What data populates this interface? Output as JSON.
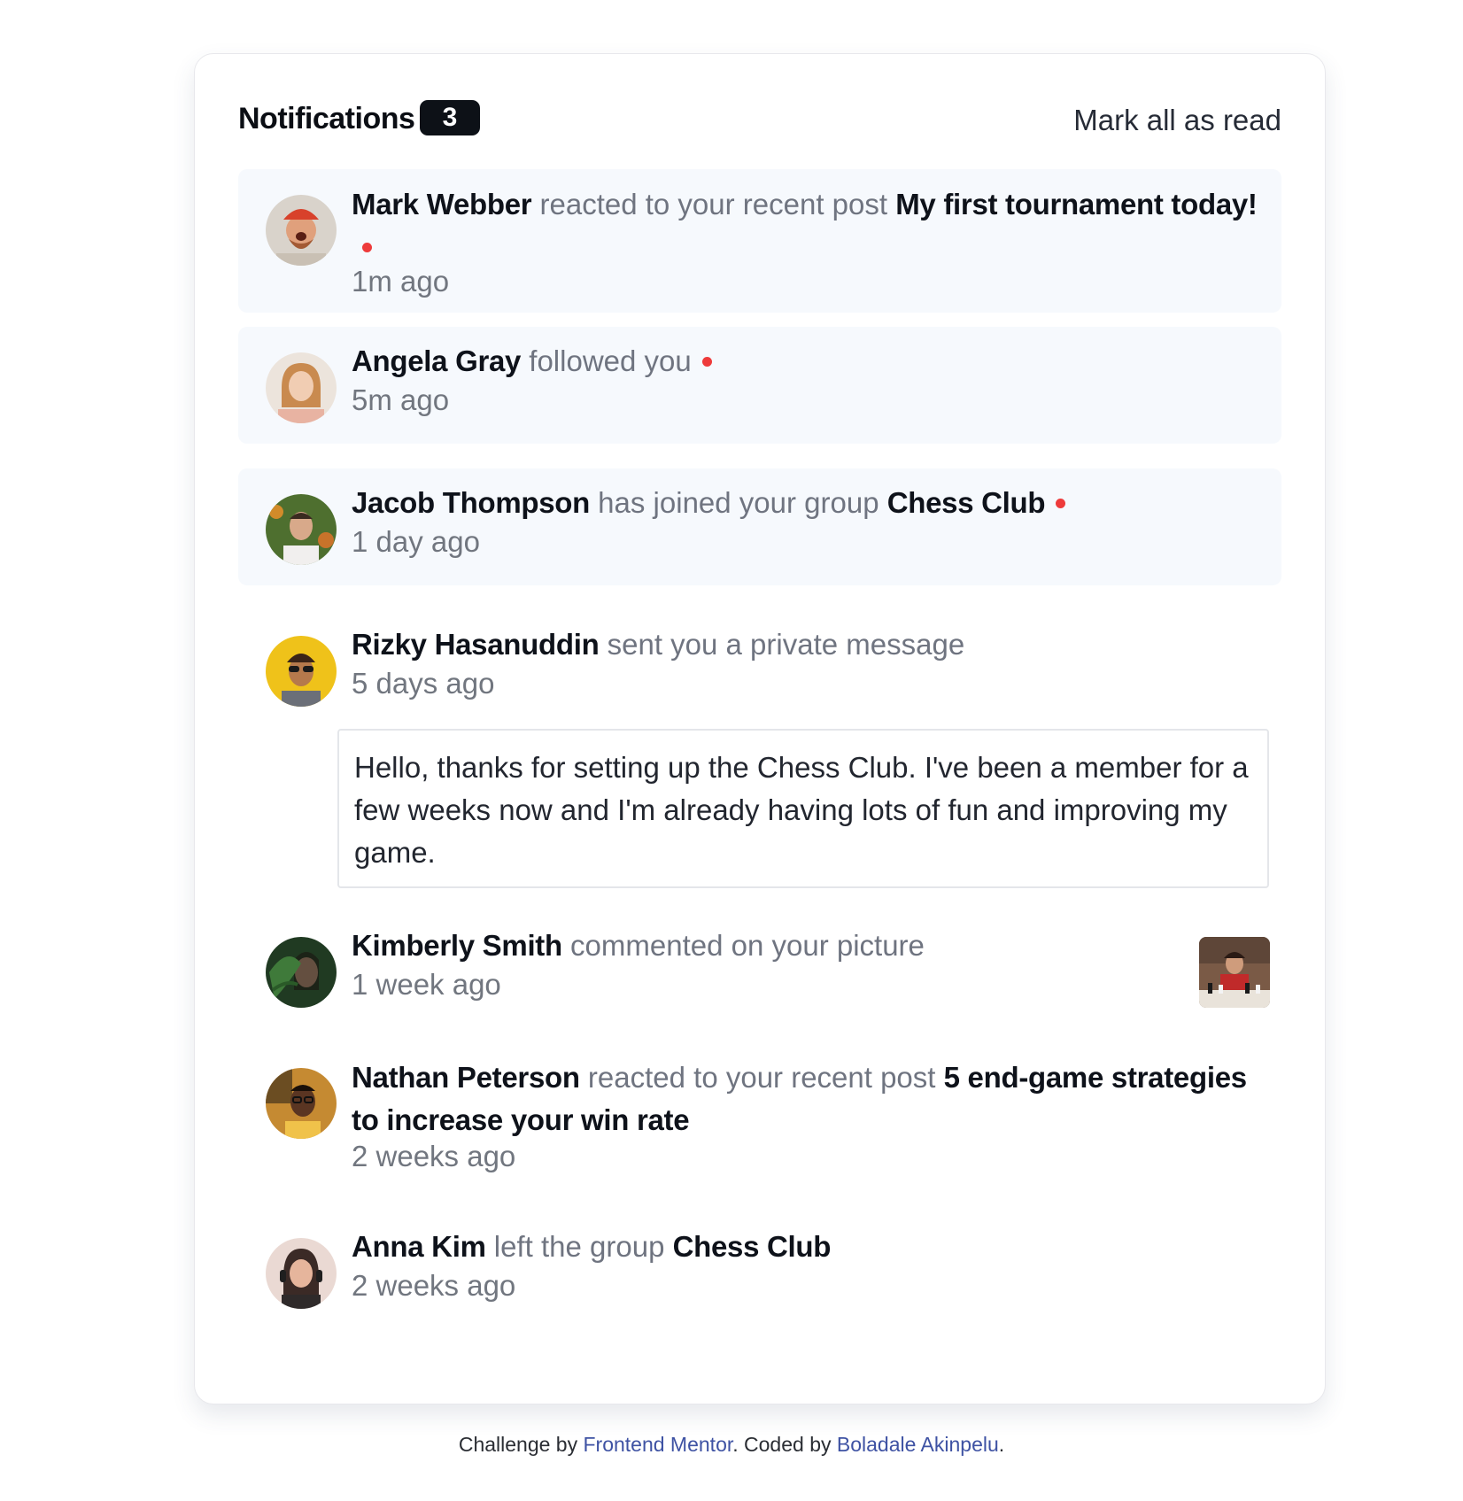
{
  "header": {
    "title": "Notifications",
    "unread_count": "3",
    "mark_all_label": "Mark all as read"
  },
  "notifications": [
    {
      "name": "Mark Webber",
      "action": "reacted to your recent post",
      "target": "My first tournament today!",
      "time": "1m ago",
      "unread": true
    },
    {
      "name": "Angela Gray",
      "action": "followed you",
      "target": "",
      "time": "5m ago",
      "unread": true
    },
    {
      "name": "Jacob Thompson",
      "action": "has joined your group",
      "target": "Chess Club",
      "time": "1 day ago",
      "unread": true
    },
    {
      "name": "Rizky Hasanuddin",
      "action": "sent you a private message",
      "target": "",
      "time": "5 days ago",
      "unread": false,
      "message": "Hello, thanks for setting up the Chess Club. I've been a member for a few weeks now and I'm already having lots of fun and improving my game."
    },
    {
      "name": "Kimberly Smith",
      "action": "commented on your picture",
      "target": "",
      "time": "1 week ago",
      "unread": false
    },
    {
      "name": "Nathan Peterson",
      "action": "reacted to your recent post",
      "target": "5 end-game strategies to increase your win rate",
      "time": "2 weeks ago",
      "unread": false
    },
    {
      "name": "Anna Kim",
      "action": "left the group",
      "target": "Chess Club",
      "time": "2 weeks ago",
      "unread": false
    }
  ],
  "footer": {
    "prefix": "Challenge by",
    "link1": "Frontend Mentor",
    "middle": ". Coded by",
    "link2": "Boladale Akinpelu",
    "suffix": "."
  },
  "colors": {
    "unread_bg": "#f6f9fd",
    "unread_dot": "#ee3b3b",
    "badge_bg": "#0d1117",
    "link": "#3e52a3"
  }
}
